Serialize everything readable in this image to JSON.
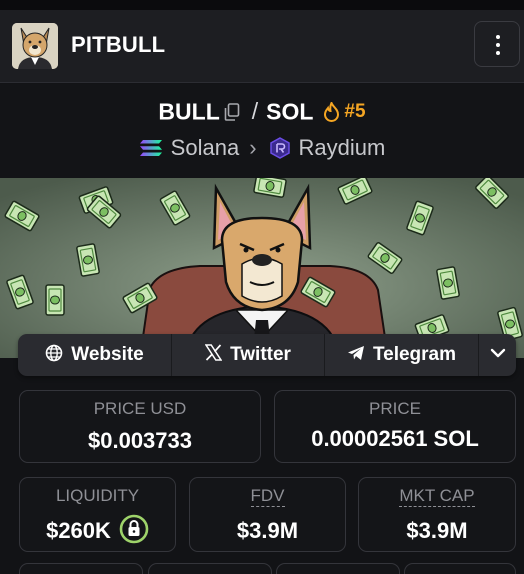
{
  "header": {
    "token_name": "PITBULL"
  },
  "pair": {
    "base": "BULL",
    "separator": "/",
    "quote": "SOL",
    "rank": "#5",
    "chain": "Solana",
    "dex": "Raydium"
  },
  "links": {
    "website": "Website",
    "twitter": "Twitter",
    "telegram": "Telegram"
  },
  "stats": {
    "price_usd_label": "PRICE USD",
    "price_usd": "$0.003733",
    "price_label": "PRICE",
    "price": "0.00002561 SOL",
    "liquidity_label": "LIQUIDITY",
    "liquidity": "$260K",
    "fdv_label": "FDV",
    "fdv": "$3.9M",
    "mkt_cap_label": "MKT CAP",
    "mkt_cap": "$3.9M"
  },
  "colors": {
    "background": "#121316",
    "header": "#1d1e22",
    "rank_orange": "#f5a623",
    "lock_green": "#9ed36a",
    "raydium_purple": "#6b4de6"
  }
}
